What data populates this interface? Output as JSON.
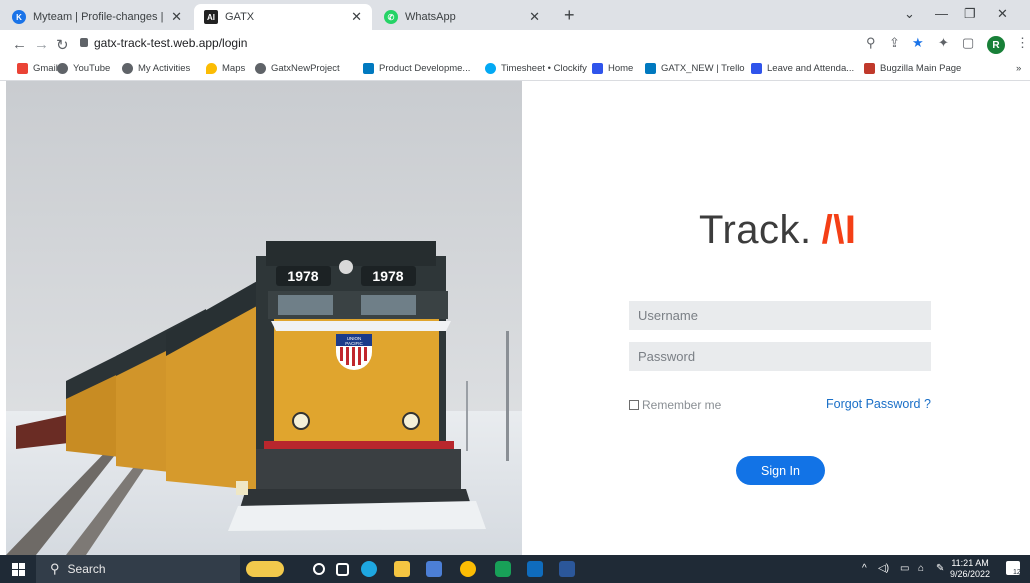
{
  "browser": {
    "tabs": [
      {
        "label": "Myteam | Profile-changes | Profil",
        "icon": "myteam-icon",
        "color": "#1a73e8",
        "active": false
      },
      {
        "label": "GATX",
        "icon": "gatx-icon",
        "color": "#222222",
        "active": true
      },
      {
        "label": "WhatsApp",
        "icon": "whatsapp-icon",
        "color": "#25d366",
        "active": false
      }
    ],
    "new_tab_label": "+",
    "url": "gatx-track-test.web.app/login",
    "profile_initial": "R",
    "bookmarks": [
      {
        "label": "Gmail",
        "icon": "gmail-icon",
        "color": "#ea4335"
      },
      {
        "label": "YouTube",
        "icon": "globe-icon",
        "color": "#5f6368"
      },
      {
        "label": "My Activities",
        "icon": "globe-icon",
        "color": "#5f6368"
      },
      {
        "label": "Maps",
        "icon": "maps-icon",
        "color": "#fbbc04"
      },
      {
        "label": "GatxNewProject",
        "icon": "globe-icon",
        "color": "#5f6368"
      },
      {
        "label": "Product Developme...",
        "icon": "trello-icon",
        "color": "#0079bf"
      },
      {
        "label": "Timesheet • Clockify",
        "icon": "clockify-icon",
        "color": "#03a9f4"
      },
      {
        "label": "Home",
        "icon": "bp-icon",
        "color": "#2f54eb"
      },
      {
        "label": "GATX_NEW | Trello",
        "icon": "trello-icon",
        "color": "#0079bf"
      },
      {
        "label": "Leave and Attenda...",
        "icon": "bp-icon",
        "color": "#2f54eb"
      },
      {
        "label": "Bugzilla Main Page",
        "icon": "bugzilla-icon",
        "color": "#c0392b"
      }
    ],
    "more_bookmarks": "»"
  },
  "login": {
    "logo_text": "Track.",
    "logo_accent": "/\\I",
    "logo_accent_color": "#f43f16",
    "username_placeholder": "Username",
    "password_placeholder": "Password",
    "remember_label": "Remember me",
    "forgot_label": "Forgot Password ?",
    "signin_label": "Sign In",
    "button_color": "#1273e6"
  },
  "photo": {
    "loco_number": "1978",
    "badge_top": "UNION",
    "badge_bottom": "PACIFIC"
  },
  "taskbar": {
    "search_label": "Search",
    "time": "11:21 AM",
    "date": "9/26/2022",
    "notification_count": "12"
  }
}
